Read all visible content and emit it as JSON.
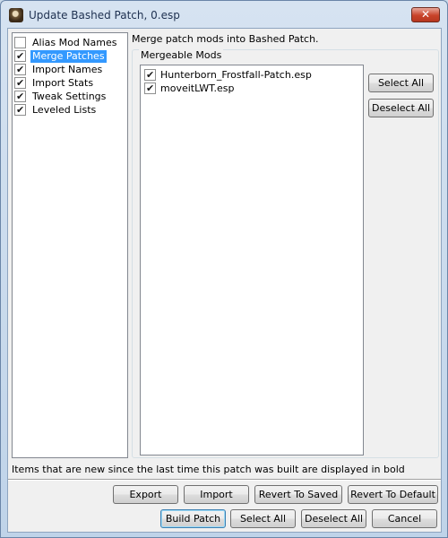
{
  "window": {
    "title": "Update Bashed Patch, 0.esp",
    "close_glyph": "✕"
  },
  "sidebar": {
    "items": [
      {
        "label": "Alias Mod Names",
        "checked": false,
        "selected": false
      },
      {
        "label": "Merge Patches",
        "checked": true,
        "selected": true
      },
      {
        "label": "Import Names",
        "checked": true,
        "selected": false
      },
      {
        "label": "Import Stats",
        "checked": true,
        "selected": false
      },
      {
        "label": "Tweak Settings",
        "checked": true,
        "selected": false
      },
      {
        "label": "Leveled Lists",
        "checked": true,
        "selected": false
      }
    ]
  },
  "main": {
    "description": "Merge patch mods into Bashed Patch.",
    "group_title": "Mergeable Mods",
    "mods": [
      {
        "label": "Hunterborn_Frostfall-Patch.esp",
        "checked": true
      },
      {
        "label": "moveitLWT.esp",
        "checked": true
      }
    ],
    "select_all_label": "Select All",
    "deselect_all_label": "Deselect All"
  },
  "footer": {
    "note": "Items that are new since the last time this patch was built are displayed in bold",
    "export_label": "Export",
    "import_label": "Import",
    "revert_saved_label": "Revert To Saved",
    "revert_default_label": "Revert To Default",
    "build_label": "Build Patch",
    "select_all_label": "Select All",
    "deselect_all_label": "Deselect All",
    "cancel_label": "Cancel"
  },
  "icons": {
    "check": "✔"
  }
}
